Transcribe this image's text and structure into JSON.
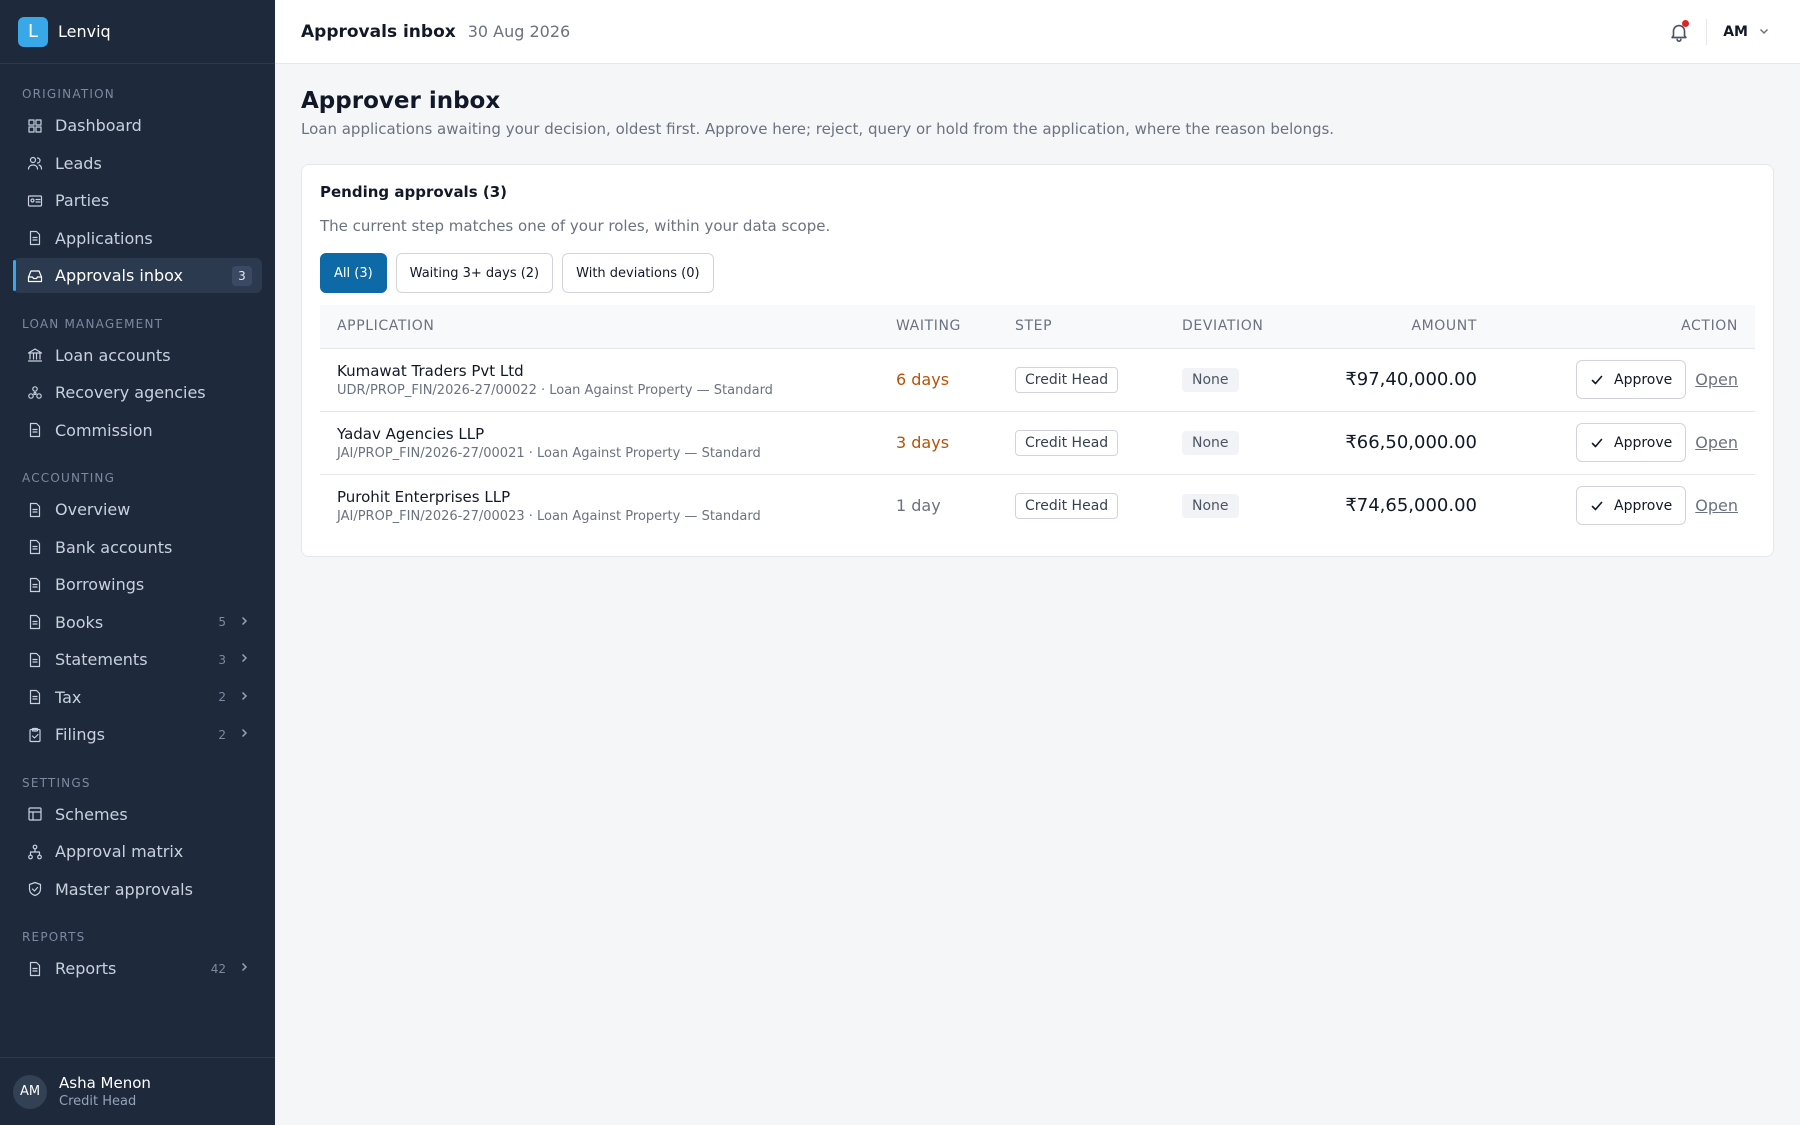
{
  "app": {
    "logo_letter": "L",
    "name": "Lenviq"
  },
  "topbar": {
    "title": "Approvals inbox",
    "date": "30 Aug 2026",
    "user_initials": "AM"
  },
  "sidebar": {
    "sections": [
      {
        "title": "ORIGINATION",
        "items": [
          {
            "label": "Dashboard",
            "icon": "grid-icon"
          },
          {
            "label": "Leads",
            "icon": "users-icon"
          },
          {
            "label": "Parties",
            "icon": "id-card-icon"
          },
          {
            "label": "Applications",
            "icon": "document-icon"
          },
          {
            "label": "Approvals inbox",
            "icon": "inbox-icon",
            "badge": "3",
            "active": true
          }
        ]
      },
      {
        "title": "LOAN MANAGEMENT",
        "items": [
          {
            "label": "Loan accounts",
            "icon": "bank-icon"
          },
          {
            "label": "Recovery agencies",
            "icon": "network-icon"
          },
          {
            "label": "Commission",
            "icon": "document-icon"
          }
        ]
      },
      {
        "title": "ACCOUNTING",
        "items": [
          {
            "label": "Overview",
            "icon": "document-icon"
          },
          {
            "label": "Bank accounts",
            "icon": "document-icon"
          },
          {
            "label": "Borrowings",
            "icon": "document-icon"
          },
          {
            "label": "Books",
            "icon": "document-icon",
            "count": "5"
          },
          {
            "label": "Statements",
            "icon": "document-icon",
            "count": "3"
          },
          {
            "label": "Tax",
            "icon": "document-icon",
            "count": "2"
          },
          {
            "label": "Filings",
            "icon": "clipboard-icon",
            "count": "2"
          }
        ]
      },
      {
        "title": "SETTINGS",
        "items": [
          {
            "label": "Schemes",
            "icon": "scheme-icon"
          },
          {
            "label": "Approval matrix",
            "icon": "hierarchy-icon"
          },
          {
            "label": "Master approvals",
            "icon": "shield-check-icon"
          }
        ]
      },
      {
        "title": "REPORTS",
        "items": [
          {
            "label": "Reports",
            "icon": "document-icon",
            "count": "42"
          }
        ]
      }
    ],
    "user": {
      "initials": "AM",
      "name": "Asha Menon",
      "role": "Credit Head"
    }
  },
  "page": {
    "title": "Approver inbox",
    "subtitle": "Loan applications awaiting your decision, oldest first. Approve here; reject, query or hold from the application, where the reason belongs."
  },
  "card": {
    "title": "Pending approvals (3)",
    "subtitle": "The current step matches one of your roles, within your data scope.",
    "filters": [
      {
        "label": "All (3)",
        "active": true
      },
      {
        "label": "Waiting 3+ days (2)",
        "active": false
      },
      {
        "label": "With deviations (0)",
        "active": false
      }
    ],
    "table": {
      "headers": {
        "application": "APPLICATION",
        "waiting": "WAITING",
        "step": "STEP",
        "deviation": "DEVIATION",
        "amount": "AMOUNT",
        "action": "ACTION"
      },
      "rows": [
        {
          "name": "Kumawat Traders Pvt Ltd",
          "ref": "UDR/PROP_FIN/2026-27/00022 · Loan Against Property — Standard",
          "waiting": "6 days",
          "waiting_warn": true,
          "step": "Credit Head",
          "deviation": "None",
          "amount": "₹97,40,000.00",
          "approve": "Approve",
          "open": "Open"
        },
        {
          "name": "Yadav Agencies LLP",
          "ref": "JAI/PROP_FIN/2026-27/00021 · Loan Against Property — Standard",
          "waiting": "3 days",
          "waiting_warn": true,
          "step": "Credit Head",
          "deviation": "None",
          "amount": "₹66,50,000.00",
          "approve": "Approve",
          "open": "Open"
        },
        {
          "name": "Purohit Enterprises LLP",
          "ref": "JAI/PROP_FIN/2026-27/00023 · Loan Against Property — Standard",
          "waiting": "1 day",
          "waiting_warn": false,
          "step": "Credit Head",
          "deviation": "None",
          "amount": "₹74,65,000.00",
          "approve": "Approve",
          "open": "Open"
        }
      ]
    }
  },
  "colors": {
    "accent": "#0e6aa6",
    "sidebar_bg": "#1e293b",
    "logo": "#38a8e8",
    "warn": "#b45309",
    "notification_dot": "#dc2626"
  }
}
